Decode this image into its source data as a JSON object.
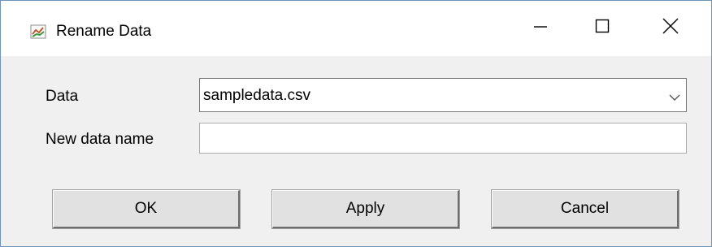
{
  "window": {
    "title": "Rename Data",
    "icon": "chart-app-icon",
    "controls": {
      "minimize_icon": "minimize-icon",
      "maximize_icon": "maximize-icon",
      "close_icon": "close-icon"
    }
  },
  "form": {
    "data_label": "Data",
    "data_selected": "sampledata.csv",
    "new_name_label": "New data name",
    "new_name_value": ""
  },
  "buttons": {
    "ok": "OK",
    "apply": "Apply",
    "cancel": "Cancel"
  },
  "colors": {
    "dialog_background": "#f0f0f0",
    "titlebar_background": "#ffffff",
    "window_border": "#6f94b8",
    "button_face": "#e1e1e1"
  }
}
